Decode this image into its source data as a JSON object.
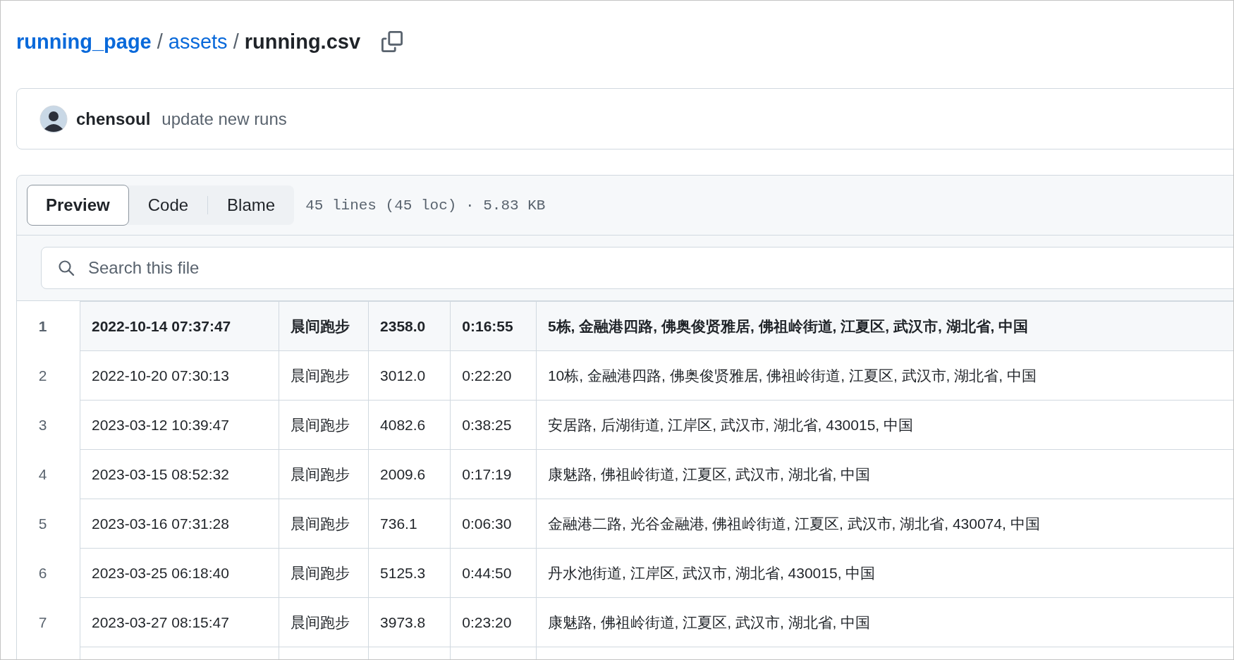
{
  "breadcrumb": {
    "links": [
      "running_page",
      "assets"
    ],
    "separator": "/",
    "current": "running.csv"
  },
  "commit": {
    "author": "chensoul",
    "message": "update new runs"
  },
  "file_header": {
    "tabs": [
      {
        "label": "Preview",
        "selected": true
      },
      {
        "label": "Code",
        "selected": false
      },
      {
        "label": "Blame",
        "selected": false
      }
    ],
    "info": "45 lines (45 loc) · 5.83 KB"
  },
  "search": {
    "placeholder": "Search this file"
  },
  "table": {
    "rows": [
      {
        "line": "1",
        "header": true,
        "cells": [
          "2022-10-14 07:37:47",
          "晨间跑步",
          "2358.0",
          "0:16:55",
          "5栋, 金融港四路, 佛奥俊贤雅居, 佛祖岭街道, 江夏区, 武汉市, 湖北省, 中国"
        ]
      },
      {
        "line": "2",
        "header": false,
        "cells": [
          "2022-10-20 07:30:13",
          "晨间跑步",
          "3012.0",
          "0:22:20",
          "10栋, 金融港四路, 佛奥俊贤雅居, 佛祖岭街道, 江夏区, 武汉市, 湖北省, 中国"
        ]
      },
      {
        "line": "3",
        "header": false,
        "cells": [
          "2023-03-12 10:39:47",
          "晨间跑步",
          "4082.6",
          "0:38:25",
          "安居路, 后湖街道, 江岸区, 武汉市, 湖北省, 430015, 中国"
        ]
      },
      {
        "line": "4",
        "header": false,
        "cells": [
          "2023-03-15 08:52:32",
          "晨间跑步",
          "2009.6",
          "0:17:19",
          "康魅路, 佛祖岭街道, 江夏区, 武汉市, 湖北省, 中国"
        ]
      },
      {
        "line": "5",
        "header": false,
        "cells": [
          "2023-03-16 07:31:28",
          "晨间跑步",
          "736.1",
          "0:06:30",
          "金融港二路, 光谷金融港, 佛祖岭街道, 江夏区, 武汉市, 湖北省, 430074, 中国"
        ]
      },
      {
        "line": "6",
        "header": false,
        "cells": [
          "2023-03-25 06:18:40",
          "晨间跑步",
          "5125.3",
          "0:44:50",
          "丹水池街道, 江岸区, 武汉市, 湖北省, 430015, 中国"
        ]
      },
      {
        "line": "7",
        "header": false,
        "cells": [
          "2023-03-27 08:15:47",
          "晨间跑步",
          "3973.8",
          "0:23:20",
          "康魅路, 佛祖岭街道, 江夏区, 武汉市, 湖北省, 中国"
        ]
      }
    ]
  }
}
